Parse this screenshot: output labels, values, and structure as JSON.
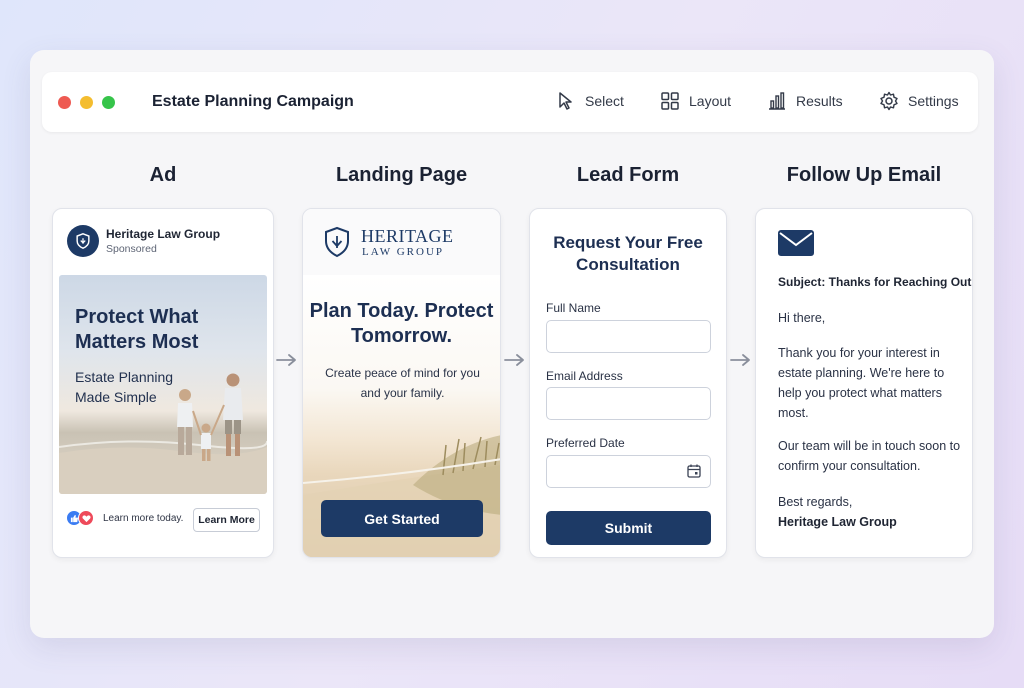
{
  "window": {
    "title": "Estate Planning Campaign",
    "toolbar": [
      {
        "label": "Select",
        "icon": "cursor-icon"
      },
      {
        "label": "Layout",
        "icon": "grid-icon"
      },
      {
        "label": "Results",
        "icon": "bar-chart-icon"
      },
      {
        "label": "Settings",
        "icon": "gear-icon"
      }
    ]
  },
  "columns": {
    "ad": "Ad",
    "landing": "Landing Page",
    "form": "Lead Form",
    "email": "Follow Up Email"
  },
  "ad": {
    "brand": "Heritage Law Group",
    "sponsored": "Sponsored",
    "headline": "Protect What Matters Most",
    "subheadline": "Estate Planning Made Simple",
    "footer_text": "Learn more today.",
    "cta": "Learn More"
  },
  "landing": {
    "brand_line1": "HERITAGE",
    "brand_line2": "LAW GROUP",
    "headline": "Plan Today. Protect Tomorrow.",
    "subtext": "Create peace of mind for you and your family.",
    "cta": "Get Started"
  },
  "form": {
    "title": "Request Your Free Consultation",
    "fields": [
      {
        "label": "Full Name",
        "value": ""
      },
      {
        "label": "Email Address",
        "value": ""
      },
      {
        "label": "Preferred Date",
        "value": ""
      }
    ],
    "submit": "Submit"
  },
  "email": {
    "subject": "Subject: Thanks for Reaching Out",
    "greeting": "Hi there,",
    "para1": "Thank you for your interest in estate planning. We're here to help you protect what matters most.",
    "para2": "Our team will be in touch soon to confirm your consultation.",
    "closing": "Best regards,",
    "signature": "Heritage Law Group"
  },
  "colors": {
    "brand_navy": "#1d3a66",
    "traffic_red": "#ee5a52",
    "traffic_yellow": "#f4bd2f",
    "traffic_green": "#36c44a"
  }
}
